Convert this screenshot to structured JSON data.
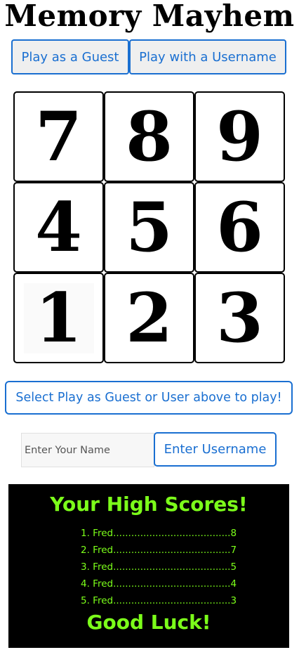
{
  "title": "Memory Mayhem",
  "mode_buttons": {
    "guest": "Play as a Guest",
    "user": "Play with a Username"
  },
  "tiles": [
    {
      "digit": "7"
    },
    {
      "digit": "8"
    },
    {
      "digit": "9"
    },
    {
      "digit": "4"
    },
    {
      "digit": "5"
    },
    {
      "digit": "6"
    },
    {
      "digit": "1"
    },
    {
      "digit": "2"
    },
    {
      "digit": "3"
    }
  ],
  "status_message": "Select Play as Guest or User above to play!",
  "username": {
    "placeholder": "Enter Your Name",
    "value": "",
    "submit_label": "Enter Username"
  },
  "high_scores": {
    "heading": "Your High Scores!",
    "entries": [
      "1. Fred.......................................8",
      "2. Fred.......................................7",
      "3. Fred.......................................5",
      "4. Fred.......................................4",
      "5. Fred.......................................3"
    ],
    "footer": "Good Luck!"
  },
  "colors": {
    "accent": "#1a6fd1",
    "score_text": "#7cff1a",
    "score_bg": "#000000"
  }
}
